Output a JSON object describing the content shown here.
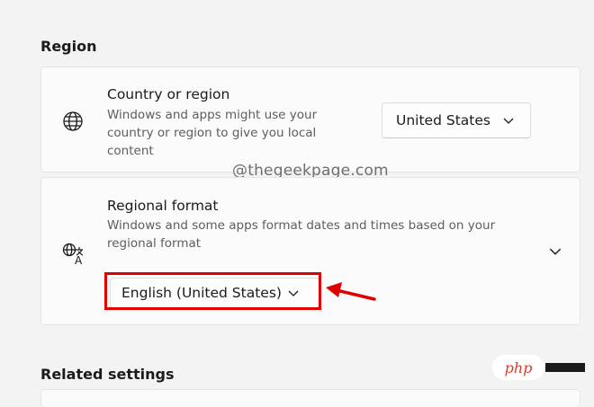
{
  "region": {
    "section_title": "Region",
    "country": {
      "title": "Country or region",
      "description_lines": [
        "Windows and apps might use your",
        "country or region to give you local",
        "content"
      ],
      "selected": "United States"
    },
    "regional_format": {
      "title": "Regional format",
      "description_lines": [
        "Windows and some apps format dates and times based on your",
        "regional format"
      ],
      "selected": "English (United States)"
    }
  },
  "related": {
    "section_title": "Related settings"
  },
  "watermark": "@thegeekpage.com",
  "logo": {
    "text": "php"
  },
  "colors": {
    "highlight": "#e00000",
    "arrow": "#e00000",
    "logo": "#e2382c"
  }
}
